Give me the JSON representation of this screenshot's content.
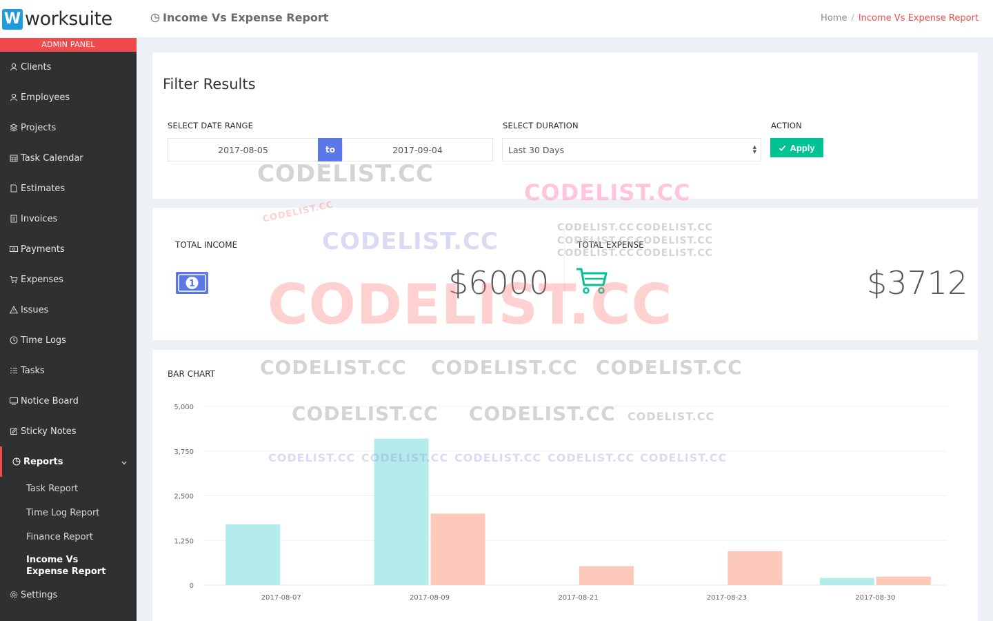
{
  "brand": {
    "logo_letter": "W",
    "logo_text": "worksuite",
    "panel_label": "ADMIN PANEL"
  },
  "sidebar": {
    "items": [
      {
        "label": "Clients",
        "icon": "user-icon"
      },
      {
        "label": "Employees",
        "icon": "user-icon"
      },
      {
        "label": "Projects",
        "icon": "layers-icon"
      },
      {
        "label": "Task Calendar",
        "icon": "calendar-icon"
      },
      {
        "label": "Estimates",
        "icon": "document-icon"
      },
      {
        "label": "Invoices",
        "icon": "receipt-icon"
      },
      {
        "label": "Payments",
        "icon": "money-icon"
      },
      {
        "label": "Expenses",
        "icon": "cart-icon"
      },
      {
        "label": "Issues",
        "icon": "warning-icon"
      },
      {
        "label": "Time Logs",
        "icon": "clock-icon"
      },
      {
        "label": "Tasks",
        "icon": "list-icon"
      },
      {
        "label": "Notice Board",
        "icon": "monitor-icon"
      },
      {
        "label": "Sticky Notes",
        "icon": "note-icon"
      },
      {
        "label": "Reports",
        "icon": "pie-chart-icon"
      }
    ],
    "report_subitems": [
      "Task Report",
      "Time Log Report",
      "Finance Report",
      "Income Vs Expense Report"
    ],
    "settings_label": "Settings"
  },
  "header": {
    "title": "Income Vs Expense Report",
    "breadcrumb_home": "Home",
    "breadcrumb_sep": "/",
    "breadcrumb_current": "Income Vs Expense Report"
  },
  "filter": {
    "title": "Filter Results",
    "date_range_label": "SELECT DATE RANGE",
    "start_date": "2017-08-05",
    "to_label": "to",
    "end_date": "2017-09-04",
    "duration_label": "SELECT DURATION",
    "duration_value": "Last 30 Days",
    "action_label": "ACTION",
    "apply_label": "Apply"
  },
  "stats": {
    "income_label": "TOTAL INCOME",
    "income_value": "$6000",
    "expense_label": "TOTAL EXPENSE",
    "expense_value": "$3712"
  },
  "chart_section": {
    "label": "BAR CHART"
  },
  "watermark": "CODELIST.CC",
  "colors": {
    "income": "#b4ecec",
    "expense": "#fbc8b9",
    "accent": "#ef4b4c",
    "apply": "#00c292",
    "to": "#5b77e8"
  },
  "chart_data": {
    "type": "bar",
    "categories": [
      "2017-08-07",
      "2017-08-09",
      "2017-08-21",
      "2017-08-23",
      "2017-08-30"
    ],
    "series": [
      {
        "values": [
          1700,
          4100,
          0,
          0,
          200
        ]
      },
      {
        "values": [
          0,
          2000,
          530,
          950,
          240
        ]
      }
    ],
    "yticks": [
      "0",
      "1,250",
      "2,500",
      "3,750",
      "5,000"
    ],
    "ylim": [
      0,
      5000
    ],
    "grid": true
  }
}
